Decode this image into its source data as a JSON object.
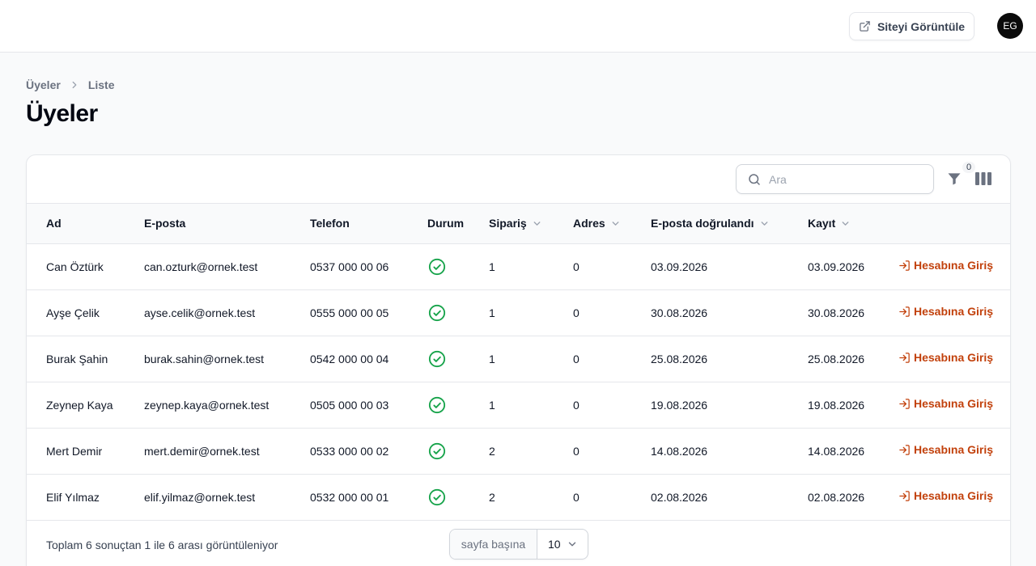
{
  "topbar": {
    "view_site_label": "Siteyi Görüntüle",
    "avatar_initials": "EG"
  },
  "breadcrumb": {
    "root": "Üyeler",
    "current": "Liste"
  },
  "page_title": "Üyeler",
  "search": {
    "placeholder": "Ara",
    "value": ""
  },
  "filter_count": "0",
  "table": {
    "headers": {
      "name": "Ad",
      "email": "E-posta",
      "phone": "Telefon",
      "status": "Durum",
      "orders": "Sipariş",
      "address": "Adres",
      "verified": "E-posta doğrulandı",
      "registered": "Kayıt"
    },
    "action_label": "Hesabına Giriş",
    "rows": [
      {
        "name": "Can Öztürk",
        "email": "can.ozturk@ornek.test",
        "phone": "0537 000 00 06",
        "orders": "1",
        "address": "0",
        "verified": "03.09.2026",
        "registered": "03.09.2026"
      },
      {
        "name": "Ayşe Çelik",
        "email": "ayse.celik@ornek.test",
        "phone": "0555 000 00 05",
        "orders": "1",
        "address": "0",
        "verified": "30.08.2026",
        "registered": "30.08.2026"
      },
      {
        "name": "Burak Şahin",
        "email": "burak.sahin@ornek.test",
        "phone": "0542 000 00 04",
        "orders": "1",
        "address": "0",
        "verified": "25.08.2026",
        "registered": "25.08.2026"
      },
      {
        "name": "Zeynep Kaya",
        "email": "zeynep.kaya@ornek.test",
        "phone": "0505 000 00 03",
        "orders": "1",
        "address": "0",
        "verified": "19.08.2026",
        "registered": "19.08.2026"
      },
      {
        "name": "Mert Demir",
        "email": "mert.demir@ornek.test",
        "phone": "0533 000 00 02",
        "orders": "2",
        "address": "0",
        "verified": "14.08.2026",
        "registered": "14.08.2026"
      },
      {
        "name": "Elif Yılmaz",
        "email": "elif.yilmaz@ornek.test",
        "phone": "0532 000 00 01",
        "orders": "2",
        "address": "0",
        "verified": "02.08.2026",
        "registered": "02.08.2026"
      }
    ]
  },
  "footer": {
    "summary": "Toplam 6 sonuçtan 1 ile 6 arası görüntüleniyor",
    "per_page_label": "sayfa başına",
    "per_page_value": "10"
  },
  "colors": {
    "accent": "#c2410c",
    "status_ok": "#16a34a"
  }
}
